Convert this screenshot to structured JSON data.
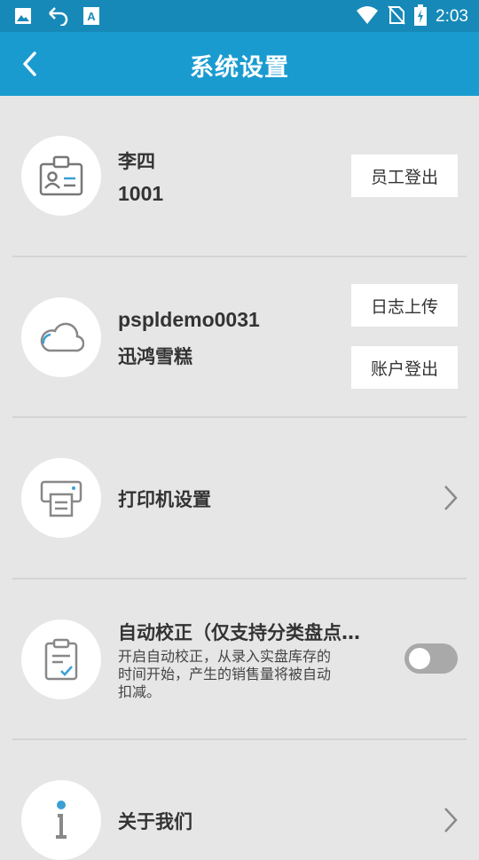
{
  "status_bar": {
    "time": "2:03",
    "left_icons": [
      "image-icon",
      "hotspot-arrow-icon",
      "font-a-icon"
    ],
    "right_icons": [
      "wifi-icon",
      "no-sim-icon",
      "battery-charging-icon"
    ]
  },
  "header": {
    "title": "系统设置",
    "back_icon": "chevron-left-icon",
    "color": "#1a9bd0"
  },
  "employee": {
    "name": "李四",
    "id": "1001",
    "logout_label": "员工登出",
    "icon": "id-card-icon"
  },
  "account": {
    "username": "pspldemo0031",
    "store": "迅鸿雪糕",
    "log_upload_label": "日志上传",
    "logout_label": "账户登出",
    "icon": "cloud-icon"
  },
  "printer": {
    "label": "打印机设置",
    "icon": "printer-icon"
  },
  "auto_correct": {
    "title": "自动校正（仅支持分类盘点…",
    "desc": "开启自动校正，从录入实盘库存的时间开始，产生的销售量将被自动扣减。",
    "enabled": false,
    "icon": "clipboard-check-icon"
  },
  "about": {
    "label": "关于我们",
    "icon": "info-icon"
  }
}
